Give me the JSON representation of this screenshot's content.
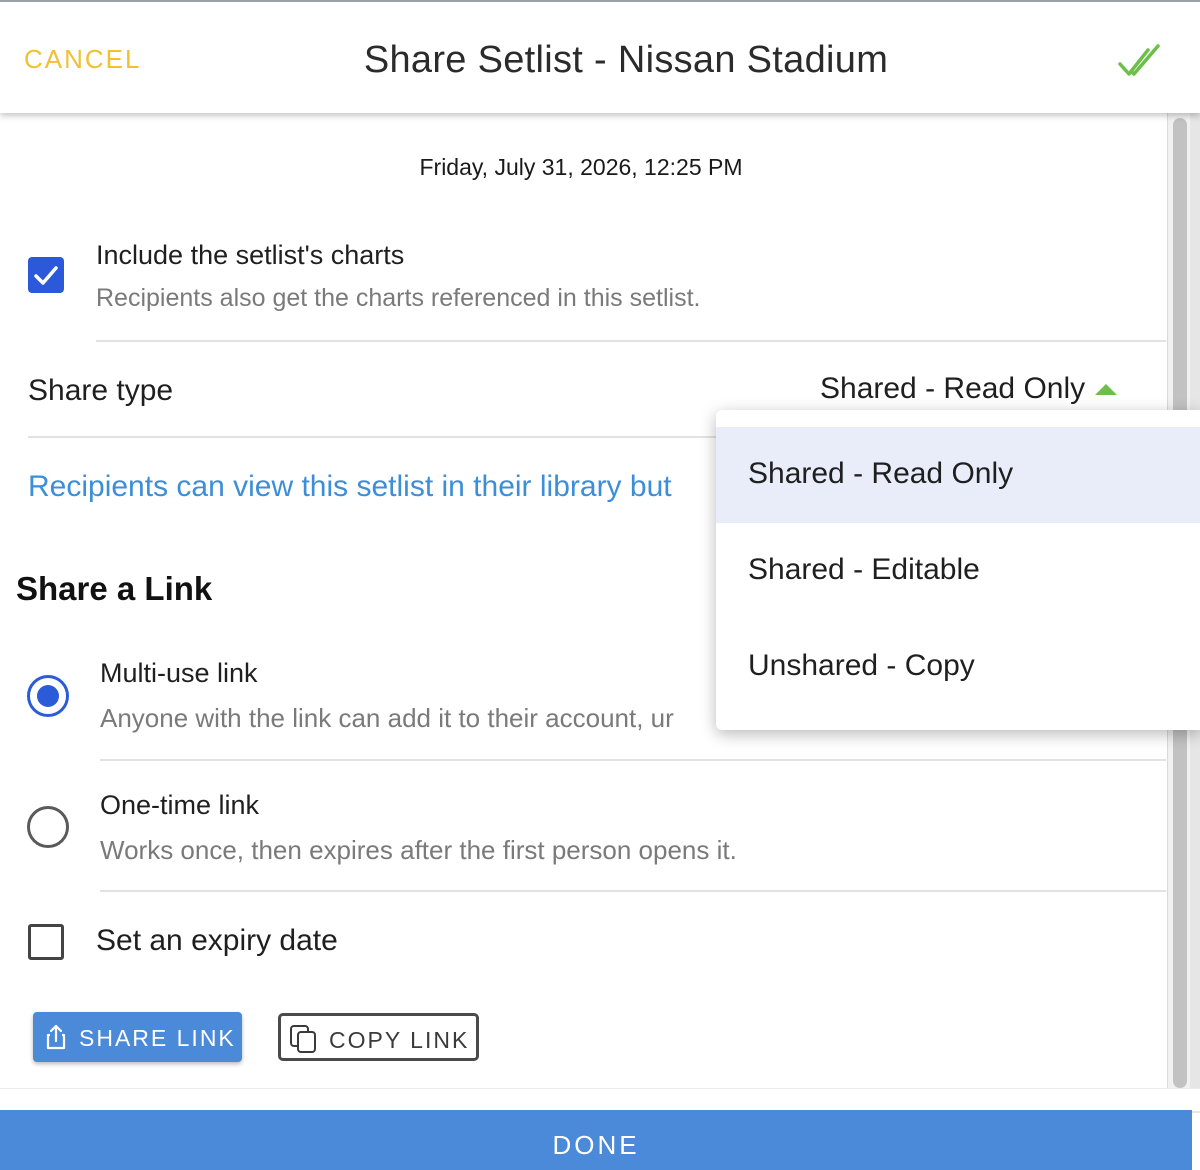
{
  "header": {
    "cancel_label": "CANCEL",
    "title": "Share Setlist - Nissan Stadium",
    "confirm_icon": "double-check-icon"
  },
  "timestamp": "Friday, July 31, 2026, 12:25 PM",
  "include_charts": {
    "checked": true,
    "title": "Include the setlist's charts",
    "subtitle": "Recipients also get the charts referenced in this setlist."
  },
  "share_type": {
    "label": "Share type",
    "selected": "Shared - Read Only",
    "description": "Recipients can view this setlist in their library but",
    "options": [
      "Shared - Read Only",
      "Shared - Editable",
      "Unshared - Copy"
    ]
  },
  "share_link": {
    "heading": "Share a Link",
    "options": [
      {
        "title": "Multi-use link",
        "subtitle": "Anyone with the link can add it to their account, ur",
        "selected": true
      },
      {
        "title": "One-time link",
        "subtitle": "Works once, then expires after the first person opens it.",
        "selected": false
      }
    ],
    "expiry_label": "Set an expiry date",
    "expiry_checked": false,
    "share_button": "SHARE LINK",
    "copy_button": "COPY LINK"
  },
  "footer": {
    "done_label": "DONE"
  },
  "colors": {
    "accent_yellow": "#f0c131",
    "accent_green": "#6cc04a",
    "primary_blue": "#4a8ad8",
    "link_blue": "#3d8ed8",
    "control_blue": "#2c59d9",
    "selected_bg": "#e8edf9"
  }
}
